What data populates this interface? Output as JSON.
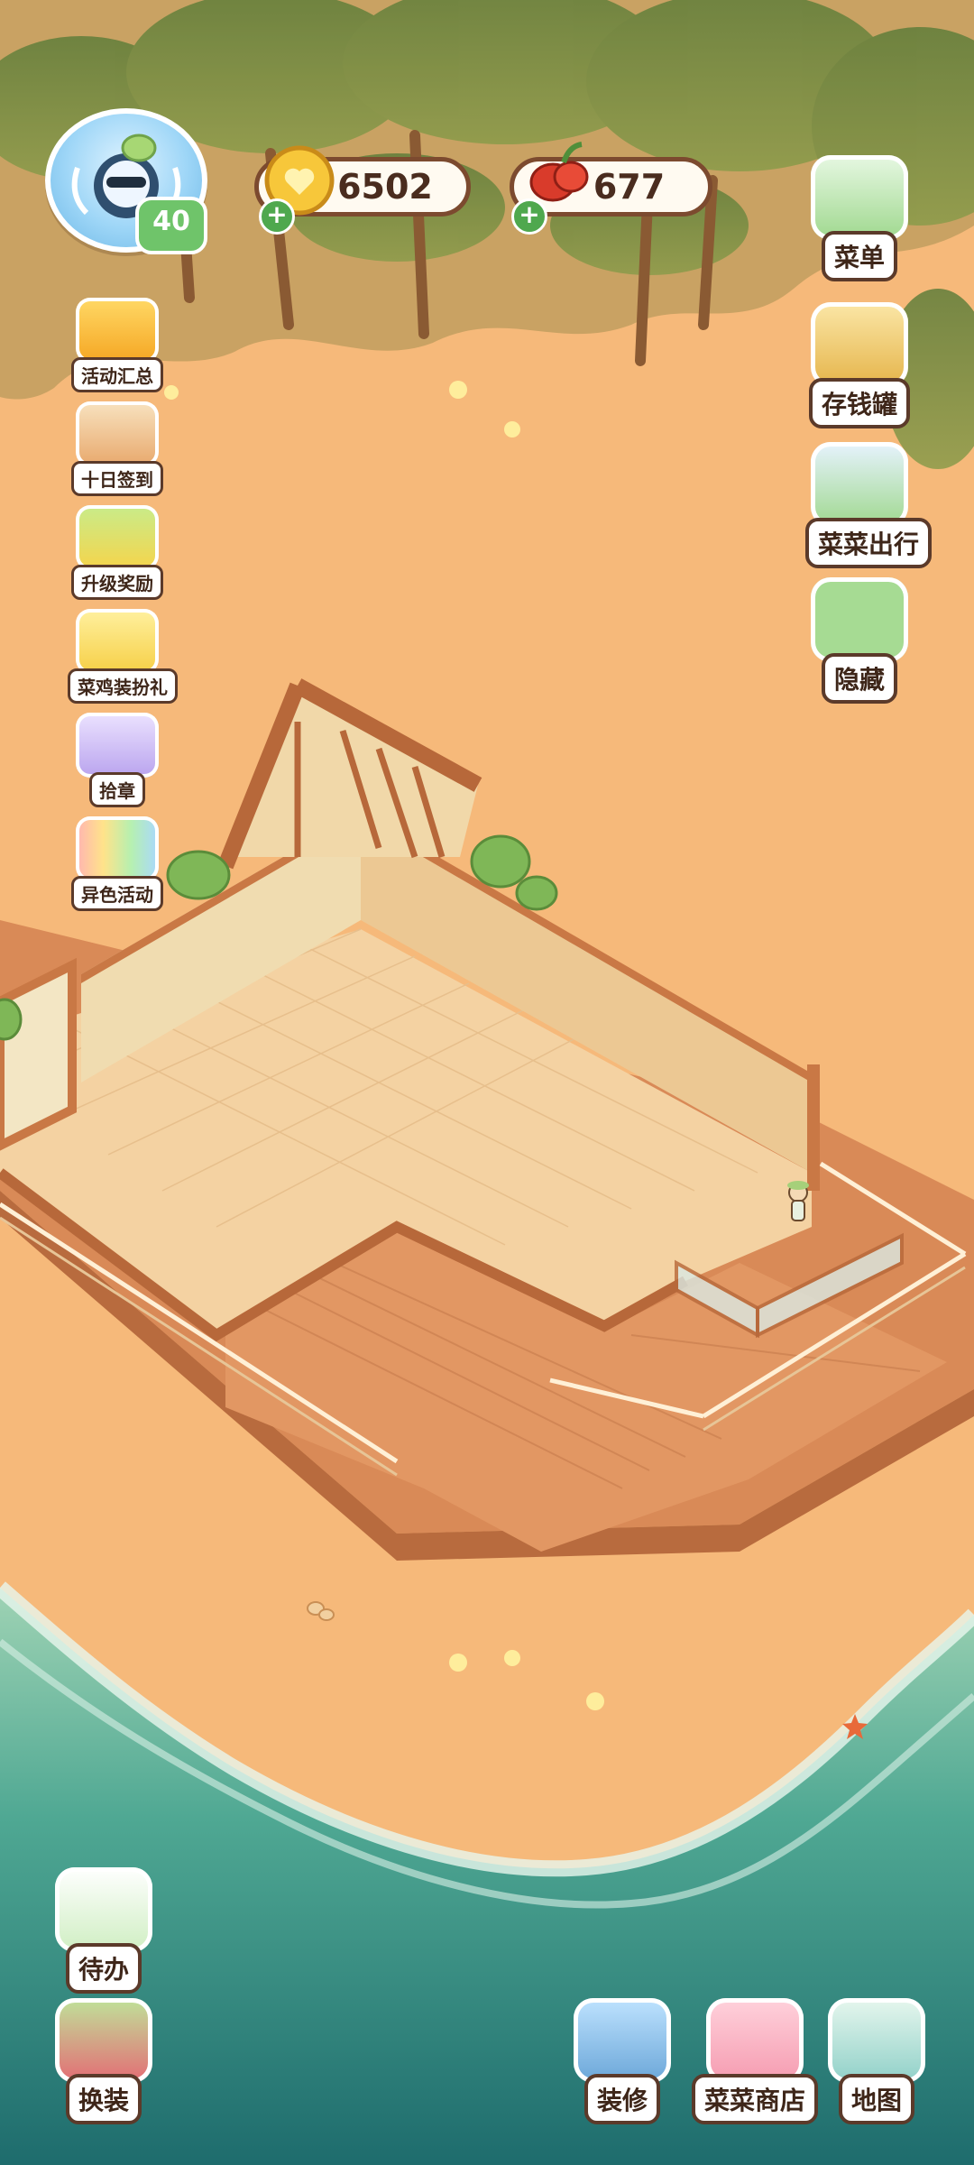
{
  "player": {
    "level": "40"
  },
  "currency": {
    "coins": "6502",
    "peppers": "677"
  },
  "left_menu": [
    {
      "label": "活动汇总",
      "icon": "activity-summary-icon"
    },
    {
      "label": "十日签到",
      "icon": "ten-day-checkin-icon"
    },
    {
      "label": "升级奖励",
      "icon": "upgrade-reward-icon"
    },
    {
      "label": "菜鸡装扮礼",
      "icon": "chick-outfit-icon"
    },
    {
      "label": "拾章",
      "icon": "stamp-pickup-icon"
    },
    {
      "label": "异色活动",
      "icon": "rainbow-event-icon"
    }
  ],
  "right_menu": [
    {
      "label": "菜单",
      "icon": "menu-list-icon"
    },
    {
      "label": "存钱罐",
      "icon": "piggy-bank-icon"
    },
    {
      "label": "菜菜出行",
      "icon": "travel-ticket-icon"
    },
    {
      "label": "隐藏",
      "icon": "hide-ui-icon"
    }
  ],
  "bottom_left": [
    {
      "label": "待办",
      "icon": "todo-icon"
    },
    {
      "label": "换装",
      "icon": "outfit-change-icon"
    }
  ],
  "bottom_right": [
    {
      "label": "装修",
      "icon": "decorate-icon"
    },
    {
      "label": "菜菜商店",
      "icon": "shop-icon"
    },
    {
      "label": "地图",
      "icon": "map-icon"
    }
  ]
}
